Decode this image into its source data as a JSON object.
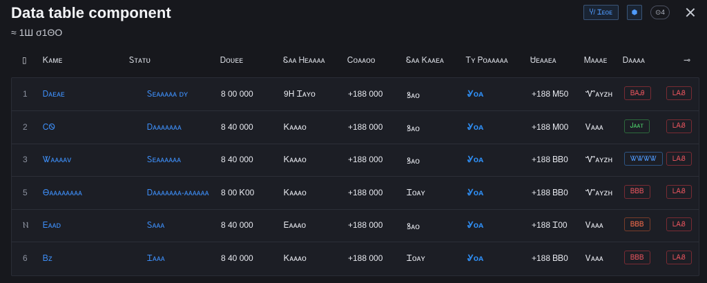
{
  "title": "Data table component",
  "subtitle": "≈ 1Ш σ1ΘΟ",
  "toolbar": {
    "button_label": "Ⴤ/ Ꮖᴇᴏᴇ",
    "icon_button_label": "⬢",
    "pill_label": "⊙4"
  },
  "columns": [
    "▯",
    "Ꮶᴀᴍᴇ",
    "Ꮪᴛᴀᴛᴜ",
    "Ꭰᴏᴜᴇᴇ",
    "Ꮛᴀᴀ Ꮋᴇᴀᴀᴀᴀ",
    "Ꮯᴏᴀᴀᴏᴏ",
    "Ꮛᴀᴀ Ꮶᴀᴀᴇᴀ",
    "Ꭲʏ Ꮲᴏᴀᴀᴀᴀᴀ",
    "Ꮜᴇᴀᴀᴇᴀ",
    "Ꮇᴀᴀᴀᴇ",
    "Ꭰᴀᴀᴀᴀ",
    "⊸"
  ],
  "rows": [
    {
      "idx": "1",
      "name": "Ꭰᴀᴇᴀᴇ",
      "status": "Ꮪᴇᴀᴀᴀᴀᴀ ᴅʏ",
      "c3": "8 00 000",
      "c4": "9ꓧ Ꮖᴀʏᴏ",
      "c5": "+188 000",
      "c6": "ꝸᴀᴏ",
      "c7": "Ꮍᴏᴀ",
      "c8": "+188 Ꮇ50",
      "c9": "Ꮙᴀʏᴢʜ",
      "badge1": "ᏴᎪᎯ",
      "badge1_color": "red",
      "badge2": "ᏞᎪᏰ"
    },
    {
      "idx": "2",
      "name": "ᏟᏫ",
      "status": "Ꭰᴀᴀᴀᴀᴀᴀᴀ",
      "c3": "8 40 000",
      "c4": "Ꮶᴀᴀᴀᴏ",
      "c5": "+188 000",
      "c6": "ꝸᴀᴏ",
      "c7": "Ꮍᴏᴀ",
      "c8": "+188 Ꮇ00",
      "c9": "Ꮩᴀᴀᴀ",
      "badge1": "Ꭻᴀᴀᴛ",
      "badge1_color": "green",
      "badge2": "ᏞᎪᏰ"
    },
    {
      "idx": "3",
      "name": "Ꮤᴀᴀᴀᴀᴠ",
      "status": "Ꮪᴇᴀᴀᴀᴀᴀᴀ",
      "c3": "8 40 000",
      "c4": "Ꮶᴀᴀᴀᴏ",
      "c5": "+188 000",
      "c6": "ꝸᴀᴏ",
      "c7": "Ꮍᴏᴀ",
      "c8": "+188 ᏴᏴ0",
      "c9": "Ꮙᴀʏᴢʜ",
      "badge1": "ᏔᏔᏔᏔ",
      "badge1_color": "blue",
      "badge2": "ᏞᎪᏰ"
    },
    {
      "idx": "5",
      "name": "Ꮎᴀᴀᴀᴀᴀᴀᴀᴀ",
      "status": "Ꭰᴀᴀᴀᴀᴀᴀᴀ-ᴀᴀᴀᴀᴀᴀ",
      "c3": "8 00 Ꮶ00",
      "c4": "Ꮶᴀᴀᴀᴏ",
      "c5": "+188 000",
      "c6": "Ꮖᴏᴀʏ",
      "c7": "Ꮍᴏᴀ",
      "c8": "+188 ᏴᏴ0",
      "c9": "Ꮙᴀʏᴢʜ",
      "badge1": "ᏴᏴᏴ",
      "badge1_color": "red",
      "badge2": "ᏞᎪᏰ"
    },
    {
      "idx": "Ⲛ",
      "name": "Ꭼᴀᴀᴅ",
      "status": "Ꮪᴀᴀᴀ",
      "c3": "8 40 000",
      "c4": "Ꭼᴀᴀᴀᴏ",
      "c5": "+188 000",
      "c6": "ꝸᴀᴏ",
      "c7": "Ꮍᴏᴀ",
      "c8": "+188 Ꮖ00",
      "c9": "Ꮩᴀᴀᴀ",
      "badge1": "ᏴᏴᏴ",
      "badge1_color": "orange",
      "badge2": "ᏞᎪᏰ"
    },
    {
      "idx": "6",
      "name": "Ᏼᴢ",
      "status": "Ꮖᴀᴀᴀ",
      "c3": "8 40 000",
      "c4": "Ꮶᴀᴀᴀᴏ",
      "c5": "+188 000",
      "c6": "Ꮖᴏᴀʏ",
      "c7": "Ꮍᴏᴀ",
      "c8": "+188 ᏴᏴ0",
      "c9": "Ꮩᴀᴀᴀ",
      "badge1": "ᏴᏴᏴ",
      "badge1_color": "red",
      "badge2": "ᏞᎪᏰ"
    }
  ],
  "colors": {
    "background": "#17181d",
    "table_background": "#1c1e25",
    "accent_blue": "#3d8df5",
    "badge_red": "#e0525b",
    "badge_green": "#4ccf6a"
  }
}
